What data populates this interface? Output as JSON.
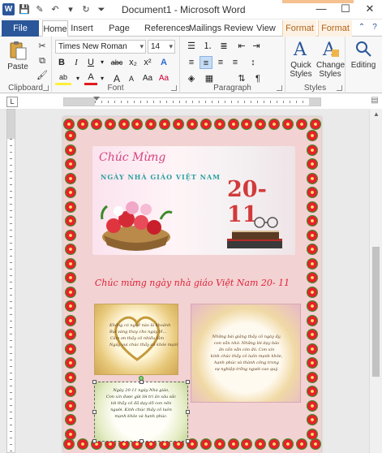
{
  "window": {
    "title": "Document1 - Microsoft Word",
    "app_icon_letter": "W",
    "controls": {
      "help": "?",
      "minimize": "—",
      "maximize": "☐",
      "close": "✕"
    }
  },
  "quick_access": [
    {
      "icon": "save-icon",
      "glyph": "💾"
    },
    {
      "icon": "format-painter-icon",
      "glyph": "✎"
    },
    {
      "icon": "undo-icon",
      "glyph": "↶"
    },
    {
      "icon": "undo-dropdown-icon",
      "glyph": "▾"
    },
    {
      "icon": "redo-icon",
      "glyph": "↻"
    },
    {
      "icon": "customize-qat-icon",
      "glyph": "⏷"
    }
  ],
  "tabs": {
    "file": "File",
    "home": "Home",
    "insert": "Insert",
    "page_layout": "Page Layout",
    "references": "References",
    "mailings": "Mailings",
    "review": "Review",
    "view": "View",
    "format1": "Format",
    "format2": "Format"
  },
  "ribbon": {
    "clipboard": {
      "label": "Clipboard",
      "paste": "Paste"
    },
    "font": {
      "label": "Font",
      "font_name": "Times New Roman",
      "font_size": "14",
      "grow": "A",
      "shrink": "A",
      "clear": "Aa",
      "bold": "B",
      "italic": "I",
      "underline": "U",
      "strike": "abc",
      "subscript": "x₂",
      "superscript": "x²",
      "effects": "A",
      "highlight": "ab",
      "color": "A",
      "size_a": "A",
      "case": "Aa"
    },
    "paragraph": {
      "label": "Paragraph",
      "show_marks": "¶"
    },
    "styles": {
      "label": "Styles",
      "quick_styles": "Quick Styles",
      "change_styles": "Change Styles"
    },
    "editing": {
      "label": "Editing"
    }
  },
  "ruler": {
    "tab_selector": "L"
  },
  "colors": {
    "word_blue": "#2b579a",
    "page_bg": "#f2d2d2",
    "greeting_red": "#e0223a",
    "date_red": "#d23a3a",
    "banner_teal": "#2aa0a0",
    "script_pink": "#d6447f"
  },
  "document": {
    "banner": {
      "script": "Chúc Mừng",
      "title": "NGÀY NHÀ GIÁO   VIỆT NAM",
      "date": "20-11"
    },
    "greeting": "Chúc mừng ngày nhà giáo Việt Nam 20- 11",
    "cards": {
      "card1_lines": [
        "Không có nghề nào là khoảnh",
        "Bụi vàng thay cho ngày lễ...",
        "Cảm ơn thầy cô nhiều lắm",
        "Ngày vui chúc thầy cô khỏe mạnh"
      ],
      "card2_lines": [
        "Những bài giảng thầy cô ngày ấy,",
        "con vẫn nhớ. Những lời dạy bảo",
        "ân cần vẫn còn đó. Con xin",
        "kính chúc thầy cô luôn mạnh khỏe,",
        "hạnh phúc và thành công trong",
        "sự nghiệp trồng người cao quý."
      ],
      "card3_lines": [
        "Ngày 20-11 ngày Nhà giáo,",
        "Con xin được gửi lời tri ân sâu sắc",
        "tới thầy cô đã dạy dỗ con nên",
        "người. Kính chúc thầy cô luôn",
        "mạnh khỏe và hạnh phúc."
      ]
    }
  }
}
